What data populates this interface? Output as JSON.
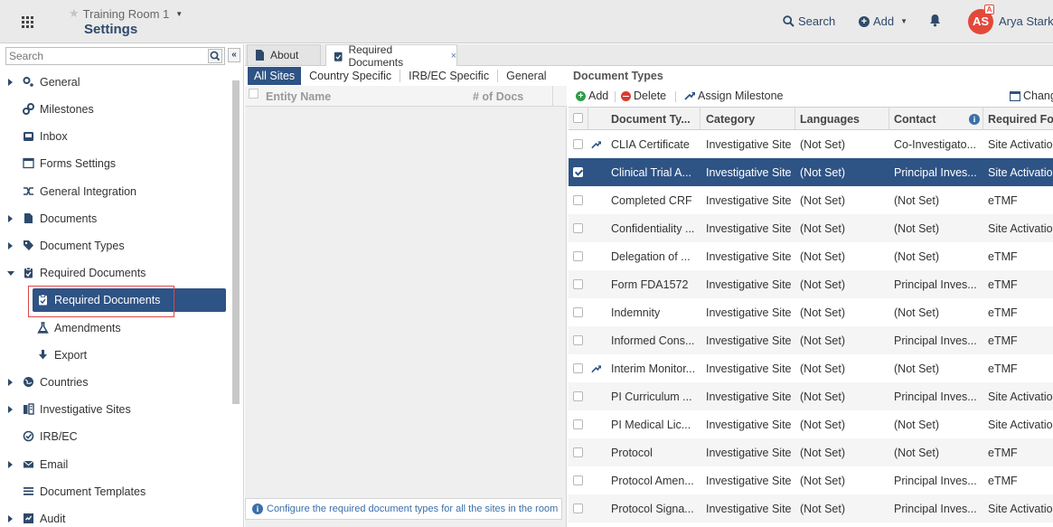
{
  "header": {
    "room_name": "Training Room 1",
    "app_title": "Settings",
    "search_label": "Search",
    "add_label": "Add",
    "avatar_initials": "AS",
    "avatar_badge": "A",
    "user_name": "Arya Stark",
    "icons": [
      "apps-grid-icon",
      "star-icon",
      "search-icon",
      "plus-circle-icon",
      "bell-icon"
    ]
  },
  "nav": {
    "search_placeholder": "Search",
    "items": [
      {
        "label": "General",
        "icon": "gears-icon",
        "expandable": true
      },
      {
        "label": "Milestones",
        "icon": "milestone-icon",
        "expandable": false
      },
      {
        "label": "Inbox",
        "icon": "inbox-icon",
        "expandable": false
      },
      {
        "label": "Forms Settings",
        "icon": "form-icon",
        "expandable": false
      },
      {
        "label": "General Integration",
        "icon": "integration-icon",
        "expandable": false
      },
      {
        "label": "Documents",
        "icon": "document-icon",
        "expandable": true
      },
      {
        "label": "Document Types",
        "icon": "tag-icon",
        "expandable": true
      },
      {
        "label": "Required Documents",
        "icon": "clipboard-icon",
        "expandable": true,
        "expanded": true
      },
      {
        "label": "Required Documents",
        "icon": "clipboard-icon",
        "child": true,
        "selected": true
      },
      {
        "label": "Amendments",
        "icon": "flask-icon",
        "child": true
      },
      {
        "label": "Export",
        "icon": "download-icon",
        "child": true
      },
      {
        "label": "Countries",
        "icon": "globe-icon",
        "expandable": true
      },
      {
        "label": "Investigative Sites",
        "icon": "building-icon",
        "expandable": true
      },
      {
        "label": "IRB/EC",
        "icon": "check-circle-icon",
        "expandable": false
      },
      {
        "label": "Email",
        "icon": "envelope-icon",
        "expandable": true
      },
      {
        "label": "Document Templates",
        "icon": "list-icon",
        "expandable": false
      },
      {
        "label": "Audit",
        "icon": "audit-icon",
        "expandable": true
      }
    ]
  },
  "tabs": [
    {
      "label": "About",
      "icon": "file-icon"
    },
    {
      "label": "Required Documents",
      "icon": "clipboard-icon",
      "active": true,
      "close": "×"
    }
  ],
  "middle": {
    "subtabs": [
      "All Sites",
      "Country Specific",
      "IRB/EC Specific",
      "General"
    ],
    "columns": [
      "Entity Name",
      "# of Docs"
    ],
    "footer_text": "Configure the required document types for all the sites in the room"
  },
  "right": {
    "title": "Document Types",
    "toolbar": {
      "add": "Add",
      "delete": "Delete",
      "assign": "Assign Milestone",
      "change": "Change"
    },
    "columns": [
      "Document Ty...",
      "Category",
      "Languages",
      "Contact",
      "Required Fo"
    ],
    "rows": [
      {
        "doc": "CLIA Certificate",
        "cat": "Investigative Site",
        "lang": "(Not Set)",
        "contact": "Co-Investigato...",
        "req": "Site Activatio",
        "milestone": true
      },
      {
        "doc": "Clinical Trial A...",
        "cat": "Investigative Site",
        "lang": "(Not Set)",
        "contact": "Principal Inves...",
        "req": "Site Activatio",
        "selected": true
      },
      {
        "doc": "Completed CRF",
        "cat": "Investigative Site",
        "lang": "(Not Set)",
        "contact": "(Not Set)",
        "req": "eTMF"
      },
      {
        "doc": "Confidentiality ...",
        "cat": "Investigative Site",
        "lang": "(Not Set)",
        "contact": "(Not Set)",
        "req": "Site Activatio"
      },
      {
        "doc": "Delegation of ...",
        "cat": "Investigative Site",
        "lang": "(Not Set)",
        "contact": "(Not Set)",
        "req": "eTMF"
      },
      {
        "doc": "Form FDA1572",
        "cat": "Investigative Site",
        "lang": "(Not Set)",
        "contact": "Principal Inves...",
        "req": "eTMF"
      },
      {
        "doc": "Indemnity",
        "cat": "Investigative Site",
        "lang": "(Not Set)",
        "contact": "(Not Set)",
        "req": "eTMF"
      },
      {
        "doc": "Informed Cons...",
        "cat": "Investigative Site",
        "lang": "(Not Set)",
        "contact": "Principal Inves...",
        "req": "eTMF"
      },
      {
        "doc": "Interim Monitor...",
        "cat": "Investigative Site",
        "lang": "(Not Set)",
        "contact": "(Not Set)",
        "req": "eTMF",
        "milestone": true
      },
      {
        "doc": "PI Curriculum ...",
        "cat": "Investigative Site",
        "lang": "(Not Set)",
        "contact": "Principal Inves...",
        "req": "Site Activatio"
      },
      {
        "doc": "PI Medical Lic...",
        "cat": "Investigative Site",
        "lang": "(Not Set)",
        "contact": "(Not Set)",
        "req": "Site Activatio"
      },
      {
        "doc": "Protocol",
        "cat": "Investigative Site",
        "lang": "(Not Set)",
        "contact": "(Not Set)",
        "req": "eTMF"
      },
      {
        "doc": "Protocol Amen...",
        "cat": "Investigative Site",
        "lang": "(Not Set)",
        "contact": "Principal Inves...",
        "req": "eTMF"
      },
      {
        "doc": "Protocol Signa...",
        "cat": "Investigative Site",
        "lang": "(Not Set)",
        "contact": "Principal Inves...",
        "req": "Site Activatio"
      }
    ]
  }
}
